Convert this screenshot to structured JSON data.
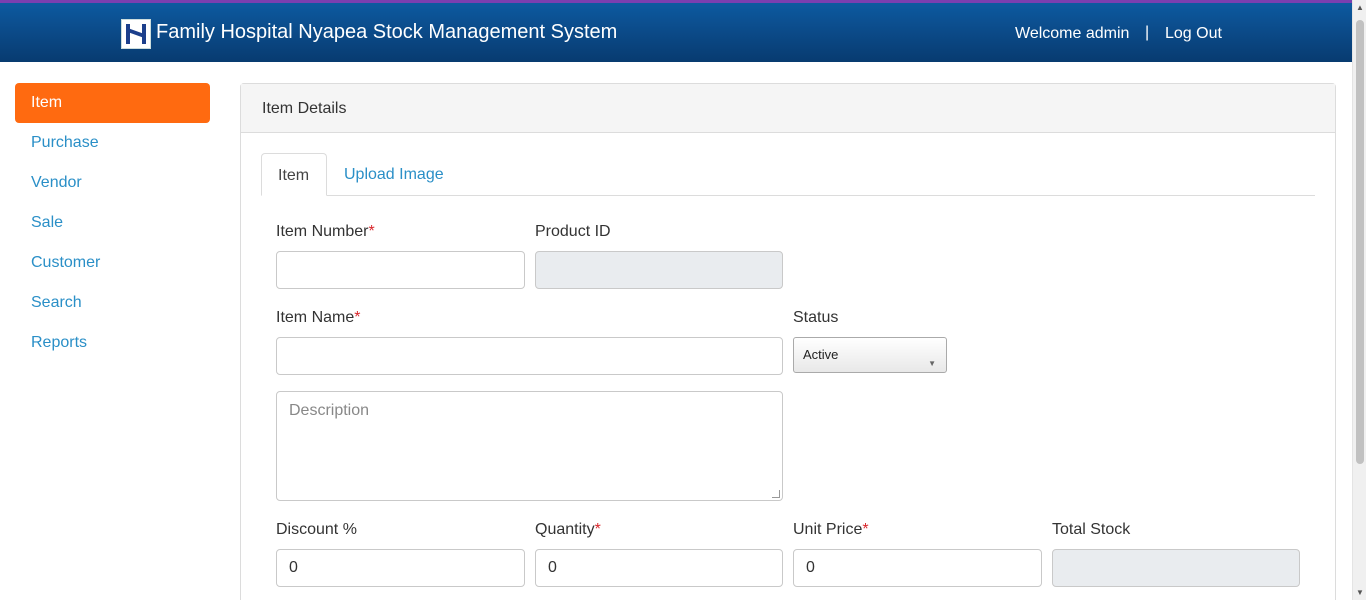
{
  "header": {
    "title": "Family Hospital Nyapea Stock Management System",
    "welcome": "Welcome admin",
    "separator": "|",
    "logout": "Log Out"
  },
  "sidebar": {
    "items": [
      {
        "label": "Item",
        "active": true
      },
      {
        "label": "Purchase"
      },
      {
        "label": "Vendor"
      },
      {
        "label": "Sale"
      },
      {
        "label": "Customer"
      },
      {
        "label": "Search"
      },
      {
        "label": "Reports"
      }
    ]
  },
  "panel": {
    "heading": "Item Details",
    "tabs": [
      {
        "label": "Item",
        "active": true
      },
      {
        "label": "Upload Image"
      }
    ]
  },
  "form": {
    "item_number": {
      "label": "Item Number",
      "required_mark": "*",
      "value": ""
    },
    "product_id": {
      "label": "Product ID",
      "value": ""
    },
    "item_name": {
      "label": "Item Name",
      "required_mark": "*",
      "value": ""
    },
    "status": {
      "label": "Status",
      "selected": "Active"
    },
    "description": {
      "placeholder": "Description"
    },
    "discount": {
      "label": "Discount %",
      "value": "0"
    },
    "quantity": {
      "label": "Quantity",
      "required_mark": "*",
      "value": "0"
    },
    "unit_price": {
      "label": "Unit Price",
      "required_mark": "*",
      "value": "0"
    },
    "total_stock": {
      "label": "Total Stock",
      "value": ""
    }
  },
  "colors": {
    "header_bg": "#0b4a88",
    "accent_active": "#ff6a10",
    "link": "#2a8fc7",
    "required": "#d9262b"
  }
}
